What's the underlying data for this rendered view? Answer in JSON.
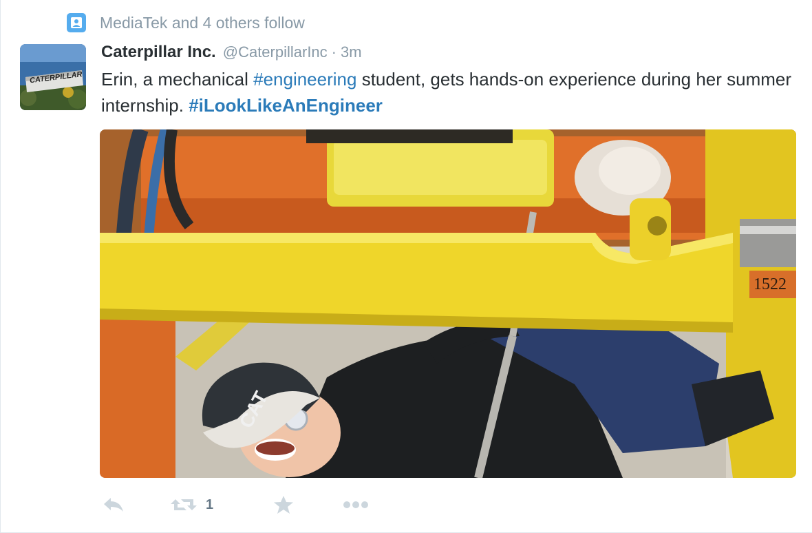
{
  "social_context": {
    "icon": "follow-person-icon",
    "text": "MediaTek and 4 others follow"
  },
  "avatar": {
    "logo_text": "CATERPILLAR"
  },
  "tweet": {
    "fullname": "Caterpillar Inc.",
    "username": "@CaterpillarInc",
    "separator": "·",
    "timestamp": "3m",
    "text_part1": "Erin, a mechanical ",
    "hashtag1": "#engineering",
    "text_part2": " student, gets hands-on experience during her summer internship. ",
    "hashtag2": "#iLookLikeAnEngineer"
  },
  "media": {
    "cap_text": "CAT",
    "machine_number": "1522"
  },
  "actions": {
    "reply_icon": "reply-icon",
    "retweet_icon": "retweet-icon",
    "retweet_count": "1",
    "favorite_icon": "star-icon",
    "more_icon": "more-dots-icon"
  },
  "colors": {
    "link": "#2b7bb9",
    "muted": "#8899a6",
    "social_icon": "#55acee",
    "action_icon": "#ccd6dd"
  }
}
